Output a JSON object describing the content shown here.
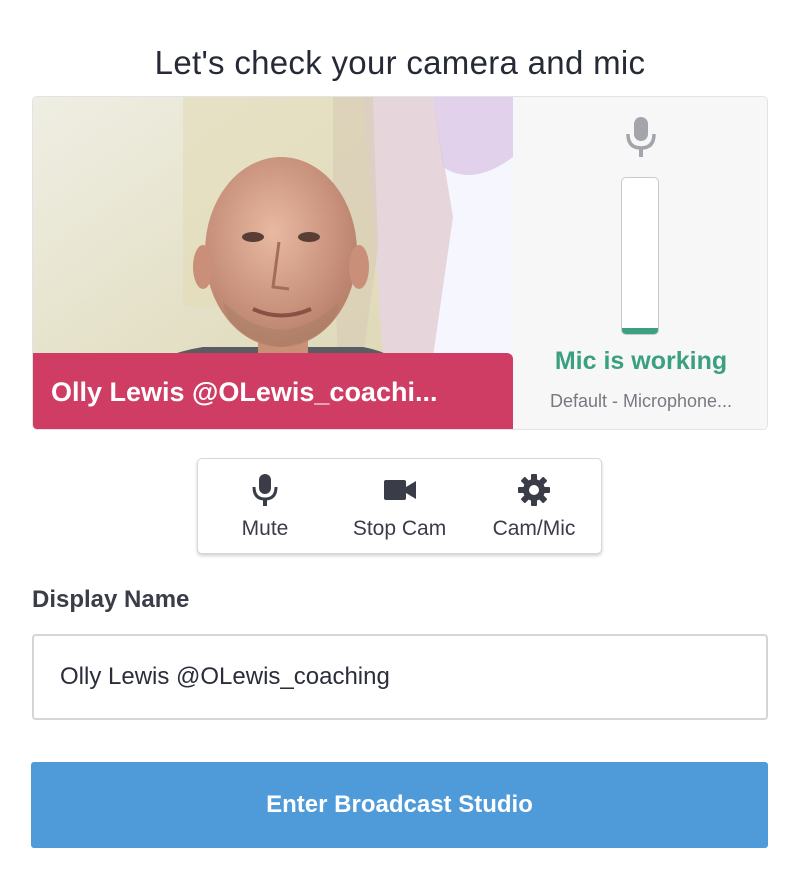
{
  "header": {
    "title": "Let's check your camera and mic"
  },
  "preview": {
    "display_name_overlay": "Olly Lewis @OLewis_coachi...",
    "mic": {
      "status": "Mic is working",
      "device": "Default - Microphone...",
      "level_fraction": 0.04,
      "status_color": "#3aa080"
    }
  },
  "controls": {
    "mute": {
      "label": "Mute",
      "icon": "microphone-icon"
    },
    "stop_cam": {
      "label": "Stop Cam",
      "icon": "video-camera-icon"
    },
    "cam_mic": {
      "label": "Cam/Mic",
      "icon": "gear-icon"
    }
  },
  "form": {
    "display_name_label": "Display Name",
    "display_name_value": "Olly Lewis @OLewis_coaching"
  },
  "actions": {
    "enter_label": "Enter Broadcast Studio"
  },
  "colors": {
    "name_bar": "#cf3d64",
    "primary_button": "#4f9bd9",
    "mic_ok": "#3aa080"
  }
}
